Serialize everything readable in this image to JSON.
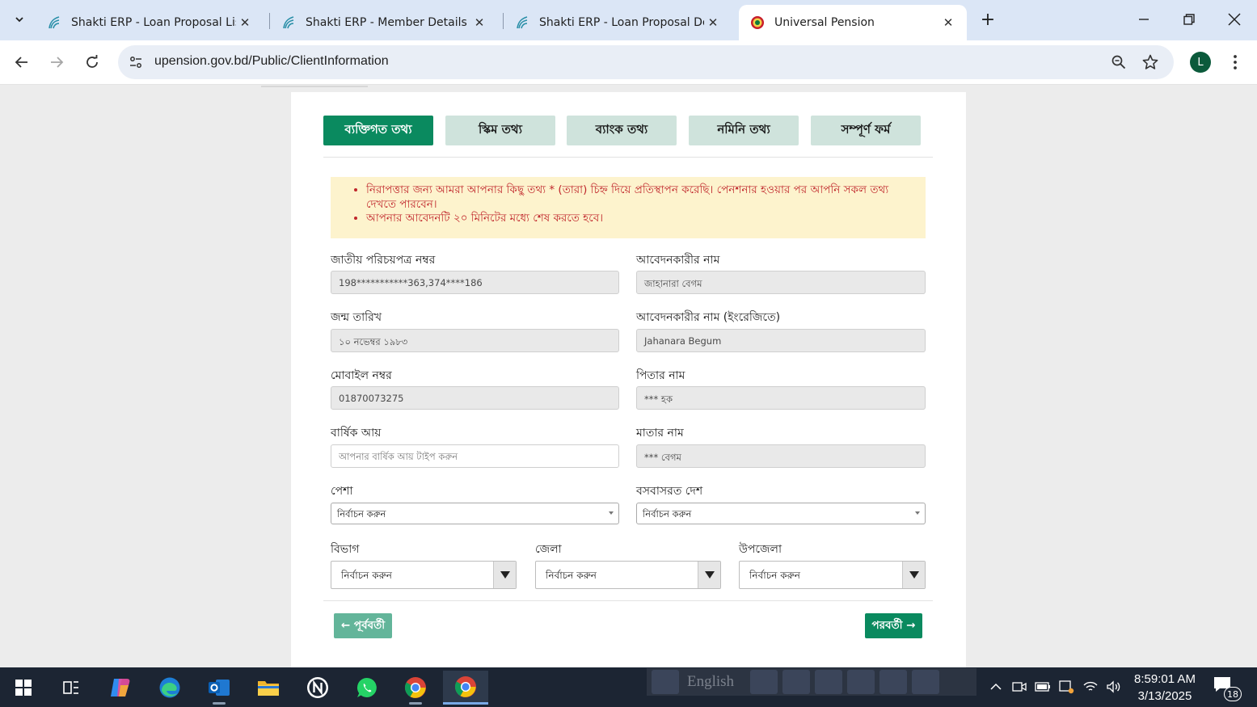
{
  "browser": {
    "tabs": [
      {
        "title": "Shakti ERP - Loan Proposal List",
        "favicon": "shakti-favicon"
      },
      {
        "title": "Shakti ERP - Member Details",
        "favicon": "shakti-favicon"
      },
      {
        "title": "Shakti ERP - Loan Proposal Det",
        "favicon": "shakti-favicon"
      },
      {
        "title": "Universal Pension",
        "favicon": "bd-govt-seal",
        "active": true
      }
    ],
    "url": "upension.gov.bd/Public/ClientInformation",
    "profile_initial": "L"
  },
  "form": {
    "steps": [
      {
        "label": "ব্যক্তিগত তথ্য",
        "active": true
      },
      {
        "label": "স্কিম তথ্য"
      },
      {
        "label": "ব্যাংক তথ্য"
      },
      {
        "label": "নমিনি তথ্য"
      },
      {
        "label": "সম্পূর্ণ ফর্ম"
      }
    ],
    "notice": [
      "নিরাপত্তার জন্য আমরা আপনার কিছু তথ্য * (তারা) চিহ্ন দিয়ে প্রতিস্থাপন করেছি। পেনশনার হওয়ার পর আপনি সকল তথ্য দেখতে পারবেন।",
      "আপনার আবেদনটি ২০ মিনিটের মধ্যে শেষ করতে হবে।"
    ],
    "nid": {
      "label": "জাতীয় পরিচয়পত্র নম্বর",
      "value": "198***********363,374****186"
    },
    "applicant_name": {
      "label": "আবেদনকারীর নাম",
      "value": "জাহানারা বেগম"
    },
    "dob": {
      "label": "জন্ম তারিখ",
      "value": "১০ নভেম্বর ১৯৮৩"
    },
    "applicant_name_en": {
      "label": "আবেদনকারীর নাম (ইংরেজিতে)",
      "value": "Jahanara Begum"
    },
    "mobile": {
      "label": "মোবাইল নম্বর",
      "value": "01870073275"
    },
    "father_name": {
      "label": "পিতার নাম",
      "value": "*** হক"
    },
    "annual_income": {
      "label": "বার্ষিক আয়",
      "placeholder": "আপনার বার্ষিক আয় টাইপ করুন",
      "value": ""
    },
    "mother_name": {
      "label": "মাতার নাম",
      "value": "*** বেগম"
    },
    "profession": {
      "label": "পেশা",
      "selected": "নির্বাচন করুন"
    },
    "country": {
      "label": "বসবাসরত দেশ",
      "selected": "নির্বাচন করুন"
    },
    "division": {
      "label": "বিভাগ",
      "selected": "নির্বাচন করুন"
    },
    "district": {
      "label": "জেলা",
      "selected": "নির্বাচন করুন"
    },
    "upazila": {
      "label": "উপজেলা",
      "selected": "নির্বাচন করুন"
    },
    "prev_label": "← পূর্ববর্তী",
    "next_label": "পরবর্তী →"
  },
  "taskbar": {
    "language": "English",
    "time": "8:59:01 AM",
    "date": "3/13/2025",
    "notification_count": "18"
  },
  "colors": {
    "primary_green": "#0a8a5f",
    "step_inactive": "#cfe3dc",
    "notice_bg": "#fdf3cd",
    "notice_text": "#c0262b"
  }
}
